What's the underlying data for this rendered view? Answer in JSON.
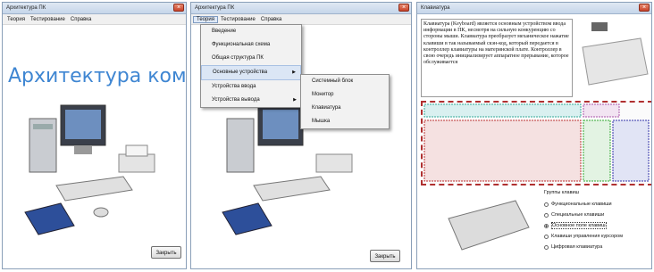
{
  "colors": {
    "accent_title": "#3f86d2",
    "highlight": "#dbe6f5"
  },
  "window1": {
    "title": "Архитектура ПК",
    "menu": [
      "Теория",
      "Тестирование",
      "Справка"
    ],
    "heading": "Архитектура компьютера",
    "close_button": "Закрыть"
  },
  "window2": {
    "title": "Архитектура ПК",
    "menu": [
      "Теория",
      "Тестирование",
      "Справка"
    ],
    "dropdown": [
      "Введение",
      "Функциональная схема",
      "Общая структура ПК",
      "Основные устройства",
      "Устройства ввода",
      "Устройства вывода"
    ],
    "submenu": [
      "Системный блок",
      "Монитор",
      "Клавиатура",
      "Мышка"
    ],
    "close_button": "Закрыть"
  },
  "window3": {
    "title": "Клавиатура",
    "text": "Клавиатура (Keyboard) является основным устройством ввода информации в ПК, несмотря на сильную конкуренцию со стороны мыши. Клавиатура преобразует механическое нажатие клавиши в так называемый скэн-код, который передается в контроллер клавиатуры на материнской плате. Контроллер в свою очередь инициализирует аппаратное прерывание, которое обслуживается",
    "group_title": "Группы клавиш",
    "radios": [
      "Функциональные клавиши",
      "Специальные клавиши",
      "Основное поле клавиш",
      "Клавиши управления курсором",
      "Цифровая клавиатура"
    ],
    "selected": 2
  }
}
